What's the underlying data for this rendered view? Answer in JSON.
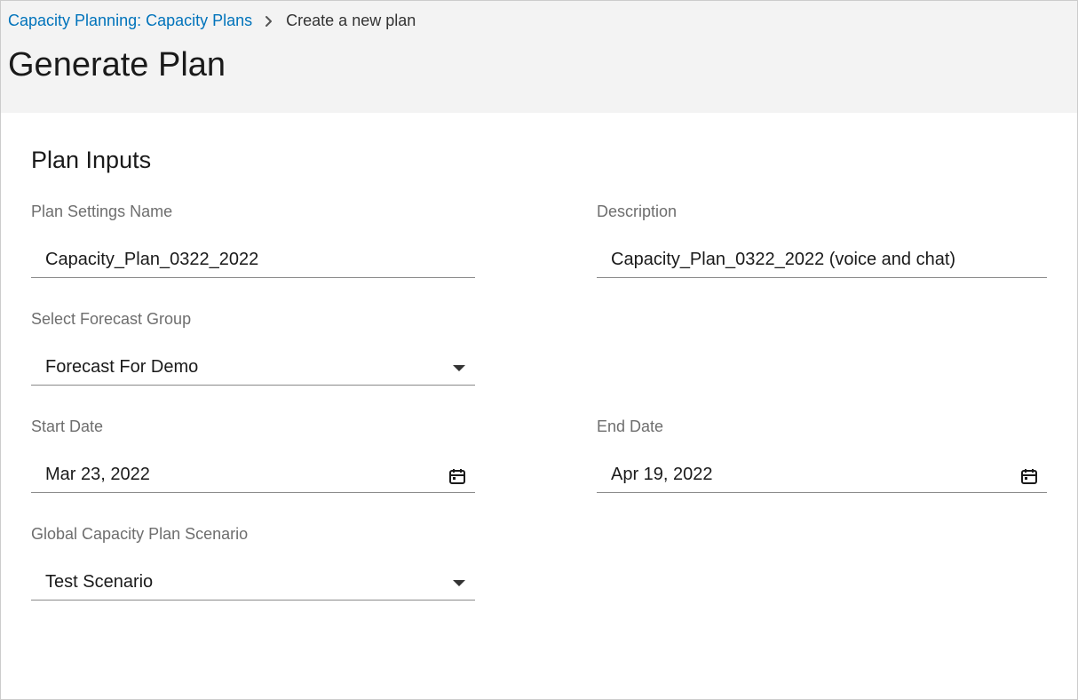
{
  "breadcrumb": {
    "link": "Capacity Planning: Capacity Plans",
    "current": "Create a new plan"
  },
  "page_title": "Generate Plan",
  "section_title": "Plan Inputs",
  "fields": {
    "plan_name": {
      "label": "Plan Settings Name",
      "value": "Capacity_Plan_0322_2022"
    },
    "description": {
      "label": "Description",
      "value": "Capacity_Plan_0322_2022 (voice and chat)"
    },
    "forecast_group": {
      "label": "Select Forecast Group",
      "value": "Forecast For Demo"
    },
    "start_date": {
      "label": "Start Date",
      "value": "Mar 23, 2022"
    },
    "end_date": {
      "label": "End Date",
      "value": "Apr 19, 2022"
    },
    "scenario": {
      "label": "Global Capacity Plan Scenario",
      "value": "Test Scenario"
    }
  }
}
